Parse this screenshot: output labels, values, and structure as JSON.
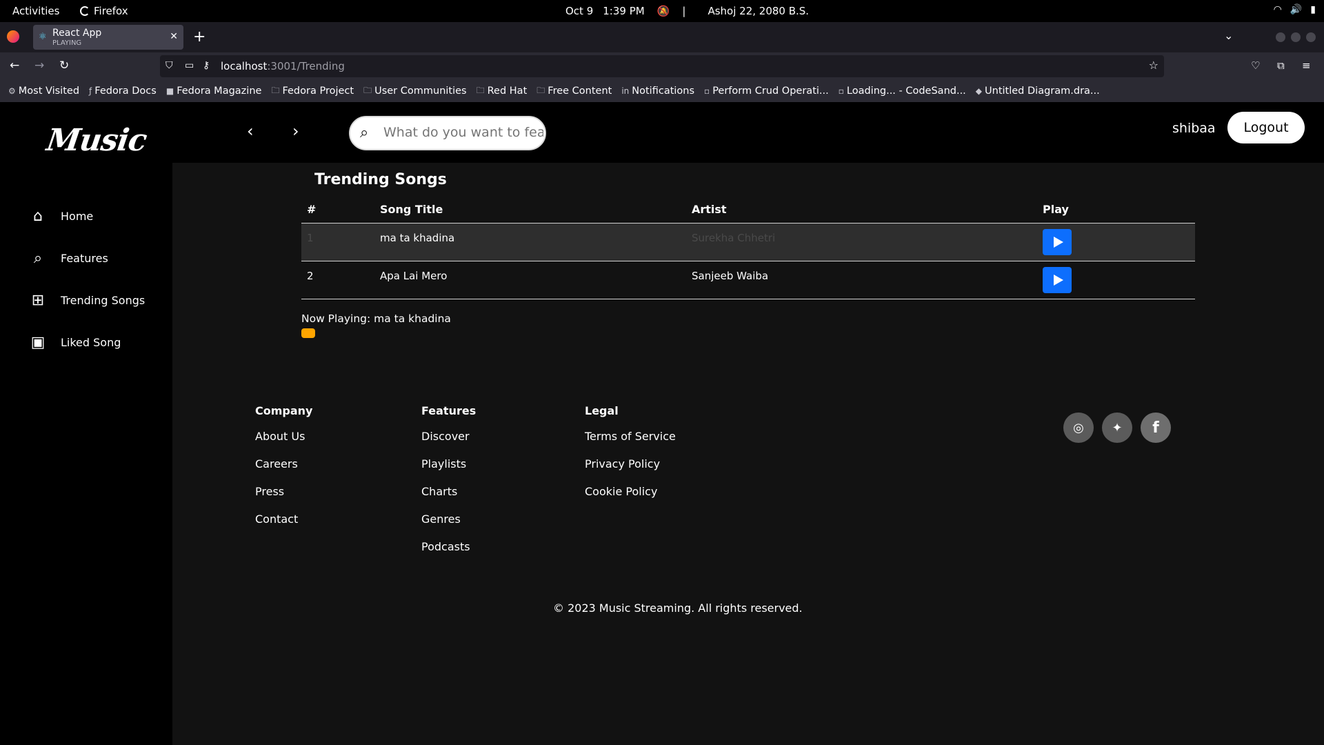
{
  "system_bar": {
    "activities": "Activities",
    "app": "Firefox",
    "date": "Oct 9",
    "time": "1:39 PM",
    "separator": "|",
    "nepali_date": "Ashoj 22, 2080 B.S."
  },
  "browser": {
    "tab_title": "React App",
    "tab_status": "PLAYING",
    "url_host": "localhost",
    "url_path": ":3001/Trending",
    "bookmarks": [
      {
        "label": "Most Visited",
        "icon": "gear-icon"
      },
      {
        "label": "Fedora Docs",
        "icon": "fedora-icon"
      },
      {
        "label": "Fedora Magazine",
        "icon": "fm-icon"
      },
      {
        "label": "Fedora Project",
        "icon": "folder-icon"
      },
      {
        "label": "User Communities",
        "icon": "folder-icon"
      },
      {
        "label": "Red Hat",
        "icon": "folder-icon"
      },
      {
        "label": "Free Content",
        "icon": "folder-icon"
      },
      {
        "label": "Notifications",
        "icon": "linkedin-icon"
      },
      {
        "label": "Perform Crud Operati...",
        "icon": "page-icon"
      },
      {
        "label": "Loading... - CodeSand...",
        "icon": "page-icon"
      },
      {
        "label": "Untitled Diagram.dra...",
        "icon": "drawio-icon"
      }
    ]
  },
  "app": {
    "logo": "Music",
    "sidebar": [
      {
        "label": "Home",
        "icon": "home-icon"
      },
      {
        "label": "Features",
        "icon": "search-icon"
      },
      {
        "label": "Trending Songs",
        "icon": "plus-square-icon"
      },
      {
        "label": "Liked Song",
        "icon": "heart-card-icon"
      }
    ],
    "search_placeholder": "What do you want to feature?",
    "username": "shibaa",
    "logout_label": "Logout",
    "section_title": "Trending Songs",
    "table_headers": {
      "num": "#",
      "title": "Song Title",
      "artist": "Artist",
      "play": "Play"
    },
    "songs": [
      {
        "num": "1",
        "title": "ma ta khadina",
        "artist": "Surekha Chhetri"
      },
      {
        "num": "2",
        "title": "Apa Lai Mero",
        "artist": "Sanjeeb Waiba"
      }
    ],
    "now_playing": "Now Playing: ma ta khadina",
    "footer": {
      "company": {
        "heading": "Company",
        "links": [
          "About Us",
          "Careers",
          "Press",
          "Contact"
        ]
      },
      "features": {
        "heading": "Features",
        "links": [
          "Discover",
          "Playlists",
          "Charts",
          "Genres",
          "Podcasts"
        ]
      },
      "legal": {
        "heading": "Legal",
        "links": [
          "Terms of Service",
          "Privacy Policy",
          "Cookie Policy"
        ]
      },
      "social": [
        "instagram-icon",
        "twitter-icon",
        "facebook-icon"
      ],
      "copyright": "© 2023 Music Streaming. All rights reserved."
    }
  },
  "colors": {
    "accent": "#0d6efd",
    "progress": "#ffa500",
    "background": "#121212"
  }
}
